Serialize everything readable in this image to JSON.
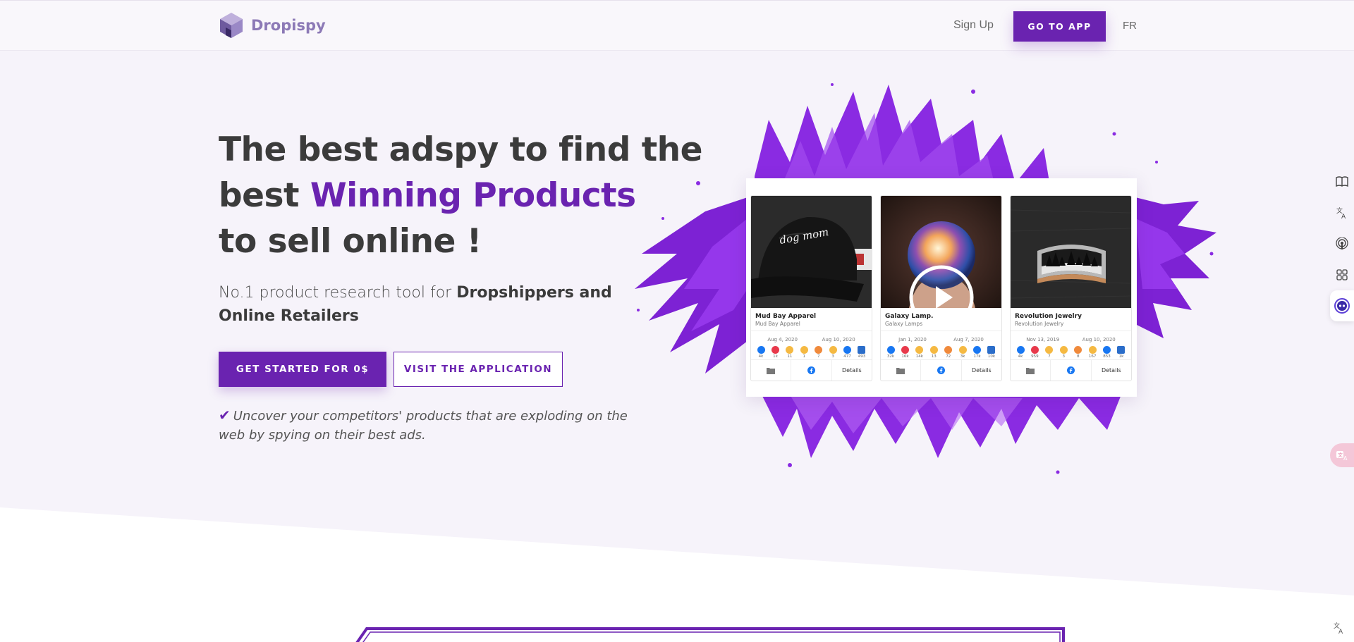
{
  "nav": {
    "brand": "Dropispy",
    "signup": "Sign Up",
    "cta": "GO TO APP",
    "lang": "FR"
  },
  "hero": {
    "title_line1": "The best adspy to find the",
    "title_line2_prefix": "best",
    "title_line2_accent": "Winning Products",
    "title_line3": "to sell online !",
    "subtitle_prefix": "No.1 product research tool for",
    "subtitle_bold": "Dropshippers and Online Retailers",
    "primary_button": "GET STARTED FOR 0$",
    "secondary_button": "VISIT THE APPLICATION",
    "note": "Uncover your competitors' products that are exploding on the web by spying on their best ads."
  },
  "cards": [
    {
      "title": "Mud Bay Apparel",
      "subtitle": "Mud Bay Apparel",
      "date_start": "Aug 4, 2020",
      "date_end": "Aug 10, 2020",
      "image_text": "dog mom",
      "counts": [
        "4k",
        "1k",
        "11",
        "1",
        "7",
        "3",
        "477",
        "493"
      ],
      "details": "Details"
    },
    {
      "title": "Galaxy Lamp.",
      "subtitle": "Galaxy Lamps",
      "date_start": "Jan 1, 2020",
      "date_end": "Aug 7, 2020",
      "counts": [
        "32k",
        "16k",
        "14k",
        "13",
        "72",
        "3k",
        "17k",
        "10k"
      ],
      "details": "Details"
    },
    {
      "title": "Revolution Jewelry",
      "subtitle": "Revolution Jewelry",
      "date_start": "Nov 13, 2019",
      "date_end": "Aug 10, 2020",
      "counts": [
        "4k",
        "959",
        "7",
        "3",
        "8",
        "167",
        "853",
        "1k"
      ],
      "details": "Details"
    }
  ],
  "reaction_colors": [
    "#1877f2",
    "#e8394b",
    "#f5b942",
    "#f5b942",
    "#f08a3c",
    "#f5b942",
    "#1877f2",
    "#2b6dc9"
  ],
  "side_tools": [
    "book-icon",
    "translate-icon",
    "podcast-icon",
    "apps-icon",
    "assistant-icon"
  ],
  "colors": {
    "accent": "#6a23b0",
    "logo": "#8c79b6",
    "text": "#3b3b3b",
    "background": "#f6f3fa"
  }
}
